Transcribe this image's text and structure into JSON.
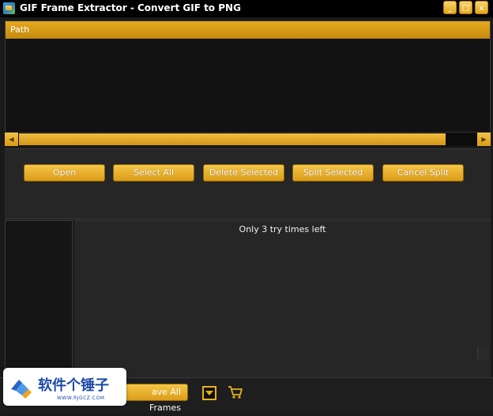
{
  "window": {
    "title": "GIF Frame Extractor - Convert GIF to PNG",
    "controls": {
      "minimize": "_",
      "maximize": "□",
      "close": "x"
    }
  },
  "path_panel": {
    "header": "Path"
  },
  "toolbar": {
    "open": "Open",
    "select_all": "Select All",
    "delete_selected": "Delete Selected",
    "split_selected": "Split Selected",
    "cancel_split": "Cancel Split"
  },
  "main": {
    "message": "Only 3 try times left"
  },
  "bottom": {
    "save_all_frames": "ave All Frames"
  },
  "watermark": {
    "text": "软件个锤子",
    "sub": "WWW.RJGCZ.COM"
  },
  "colors": {
    "accent": "#e3a61d",
    "background": "#1a1a1a",
    "panel": "#262626"
  },
  "icons": {
    "app": "app-image-icon",
    "dropdown": "caret-down-icon",
    "cart": "shopping-cart-icon"
  }
}
